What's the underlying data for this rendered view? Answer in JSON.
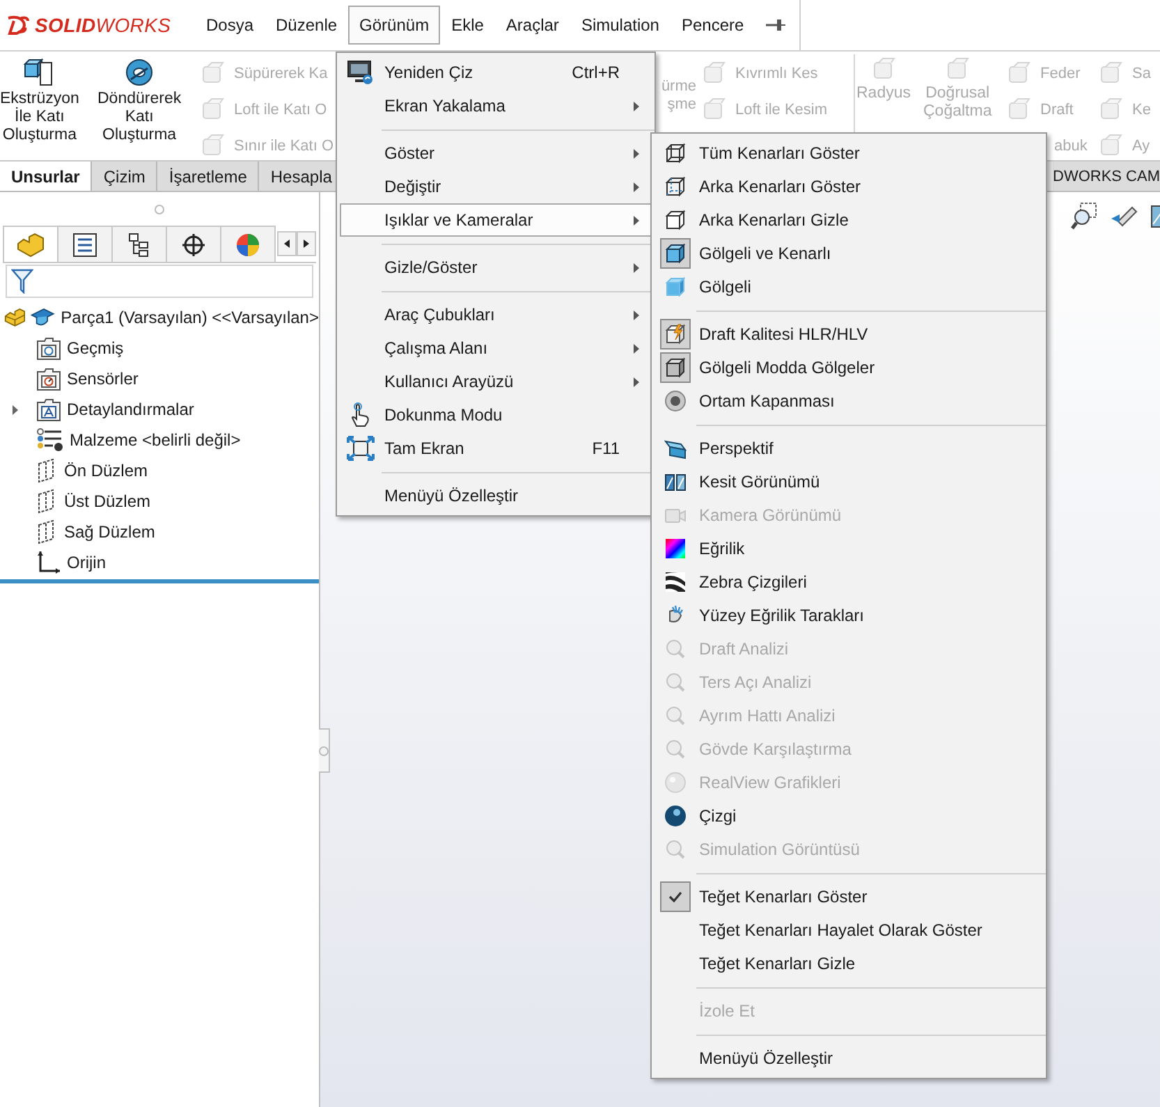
{
  "menubar": {
    "logo": "**SOLID**WORKS",
    "items": [
      {
        "label": "Dosya",
        "selected": false
      },
      {
        "label": "Düzenle",
        "selected": false
      },
      {
        "label": "Görünüm",
        "selected": true
      },
      {
        "label": "Ekle",
        "selected": false
      },
      {
        "label": "Araçlar",
        "selected": false
      },
      {
        "label": "Simulation",
        "selected": false
      },
      {
        "label": "Pencere",
        "selected": false
      }
    ]
  },
  "command_manager": {
    "columns": [
      {
        "kind": "large",
        "label": "Ekstrüzyon\nİle Katı\nOluşturma",
        "disabled": false
      },
      {
        "kind": "large",
        "label": "Döndürerek\nKatı\nOluşturma",
        "disabled": false
      },
      {
        "kind": "stack",
        "items": [
          {
            "label": "Süpürerek Ka",
            "disabled": true
          },
          {
            "label": "Loft ile Katı O",
            "disabled": true
          },
          {
            "label": "Sınır ile Katı O",
            "disabled": true
          }
        ]
      },
      {
        "kind": "fragment",
        "label": "ürme\nşme",
        "disabled": true
      },
      {
        "kind": "stack",
        "items": [
          {
            "label": "Kıvrımlı Kes",
            "disabled": true
          },
          {
            "label": "Loft ile Kesim",
            "disabled": true
          }
        ]
      },
      {
        "kind": "divider"
      },
      {
        "kind": "large",
        "label": "Radyus",
        "disabled": true
      },
      {
        "kind": "large",
        "label": "Doğrusal\nÇoğaltma",
        "disabled": true
      },
      {
        "kind": "stack",
        "items": [
          {
            "label": "Feder",
            "disabled": true
          },
          {
            "label": "Draft",
            "disabled": true
          },
          {
            "label": "abuk",
            "disabled": true
          }
        ]
      },
      {
        "kind": "stack",
        "items": [
          {
            "label": "Sa",
            "disabled": true
          },
          {
            "label": "Ke",
            "disabled": true
          },
          {
            "label": "Ay",
            "disabled": true
          }
        ]
      }
    ]
  },
  "tabs": [
    {
      "label": "Unsurlar",
      "selected": true
    },
    {
      "label": "Çizim",
      "selected": false
    },
    {
      "label": "İşaretleme",
      "selected": false
    },
    {
      "label": "Hesapla",
      "selected": false
    },
    {
      "label": "DWORKS CAM",
      "selected": false
    }
  ],
  "feature_panel": {
    "panel_tabs": [
      {
        "selected": true
      },
      {
        "selected": false
      },
      {
        "selected": false
      },
      {
        "selected": false
      },
      {
        "selected": false
      }
    ],
    "tree": {
      "label": "Parça1 (Varsayılan) <<Varsayılan>",
      "children": [
        {
          "label": "Geçmiş",
          "expandable": false
        },
        {
          "label": "Sensörler",
          "expandable": false
        },
        {
          "label": "Detaylandırmalar",
          "expandable": true
        },
        {
          "label": "Malzeme <belirli değil>",
          "expandable": false
        },
        {
          "label": "Ön Düzlem",
          "expandable": false
        },
        {
          "label": "Üst Düzlem",
          "expandable": false
        },
        {
          "label": "Sağ Düzlem",
          "expandable": false
        },
        {
          "label": "Orijin",
          "expandable": false
        }
      ]
    }
  },
  "menu": {
    "items": [
      {
        "kind": "item",
        "label": "Yeniden Çiz",
        "shortcut": "Ctrl+R",
        "submenu": false,
        "selected": false
      },
      {
        "kind": "item",
        "label": "Ekran Yakalama",
        "submenu": true,
        "selected": false
      },
      {
        "kind": "separator"
      },
      {
        "kind": "item",
        "label": "Göster",
        "submenu": true,
        "selected": false
      },
      {
        "kind": "item",
        "label": "Değiştir",
        "submenu": true,
        "selected": false
      },
      {
        "kind": "item",
        "label": "Işıklar ve Kameralar",
        "submenu": true,
        "selected": true
      },
      {
        "kind": "separator"
      },
      {
        "kind": "item",
        "label": "Gizle/Göster",
        "submenu": true,
        "selected": false
      },
      {
        "kind": "separator"
      },
      {
        "kind": "item",
        "label": "Araç Çubukları",
        "submenu": true,
        "selected": false
      },
      {
        "kind": "item",
        "label": "Çalışma Alanı",
        "submenu": true,
        "selected": false
      },
      {
        "kind": "item",
        "label": "Kullanıcı Arayüzü",
        "submenu": true,
        "selected": false
      },
      {
        "kind": "item",
        "label": "Dokunma Modu",
        "submenu": false,
        "selected": false
      },
      {
        "kind": "item",
        "label": "Tam Ekran",
        "shortcut": "F11",
        "submenu": false,
        "selected": false
      },
      {
        "kind": "separator"
      },
      {
        "kind": "item",
        "label": "Menüyü Özelleştir",
        "submenu": false,
        "selected": false
      }
    ]
  },
  "submenu": {
    "items": [
      {
        "kind": "item",
        "label": "Tüm Kenarları Göster",
        "checked": false,
        "disabled": false
      },
      {
        "kind": "item",
        "label": "Arka Kenarları Göster",
        "checked": false,
        "disabled": false
      },
      {
        "kind": "item",
        "label": "Arka Kenarları Gizle",
        "checked": false,
        "disabled": false
      },
      {
        "kind": "item",
        "label": "Gölgeli ve Kenarlı",
        "checked": true,
        "disabled": false
      },
      {
        "kind": "item",
        "label": "Gölgeli",
        "checked": false,
        "disabled": false
      },
      {
        "kind": "separator"
      },
      {
        "kind": "item",
        "label": "Draft Kalitesi HLR/HLV",
        "checked": true,
        "disabled": false
      },
      {
        "kind": "item",
        "label": "Gölgeli Modda Gölgeler",
        "checked": true,
        "disabled": false
      },
      {
        "kind": "item",
        "label": "Ortam Kapanması",
        "checked": false,
        "disabled": false
      },
      {
        "kind": "separator"
      },
      {
        "kind": "item",
        "label": "Perspektif",
        "checked": false,
        "disabled": false
      },
      {
        "kind": "item",
        "label": "Kesit Görünümü",
        "checked": false,
        "disabled": false
      },
      {
        "kind": "item",
        "label": "Kamera Görünümü",
        "checked": false,
        "disabled": true
      },
      {
        "kind": "item",
        "label": "Eğrilik",
        "checked": false,
        "disabled": false
      },
      {
        "kind": "item",
        "label": "Zebra Çizgileri",
        "checked": false,
        "disabled": false
      },
      {
        "kind": "item",
        "label": "Yüzey Eğrilik Tarakları",
        "checked": false,
        "disabled": false
      },
      {
        "kind": "item",
        "label": "Draft Analizi",
        "checked": false,
        "disabled": true
      },
      {
        "kind": "item",
        "label": "Ters Açı Analizi",
        "checked": false,
        "disabled": true
      },
      {
        "kind": "item",
        "label": "Ayrım Hattı Analizi",
        "checked": false,
        "disabled": true
      },
      {
        "kind": "item",
        "label": "Gövde Karşılaştırma",
        "checked": false,
        "disabled": true
      },
      {
        "kind": "item",
        "label": "RealView Grafikleri",
        "checked": false,
        "disabled": true
      },
      {
        "kind": "item",
        "label": "Çizgi",
        "checked": false,
        "disabled": false
      },
      {
        "kind": "item",
        "label": "Simulation Görüntüsü",
        "checked": false,
        "disabled": true
      },
      {
        "kind": "separator"
      },
      {
        "kind": "item",
        "label": "Teğet Kenarları Göster",
        "checked": true,
        "disabled": false
      },
      {
        "kind": "item",
        "label": "Teğet Kenarları Hayalet Olarak Göster",
        "checked": false,
        "disabled": false
      },
      {
        "kind": "item",
        "label": "Teğet Kenarları Gizle",
        "checked": false,
        "disabled": false
      },
      {
        "kind": "separator"
      },
      {
        "kind": "item",
        "label": "İzole Et",
        "checked": false,
        "disabled": true
      },
      {
        "kind": "separator"
      },
      {
        "kind": "item",
        "label": "Menüyü Özelleştir",
        "checked": false,
        "disabled": false
      }
    ]
  }
}
